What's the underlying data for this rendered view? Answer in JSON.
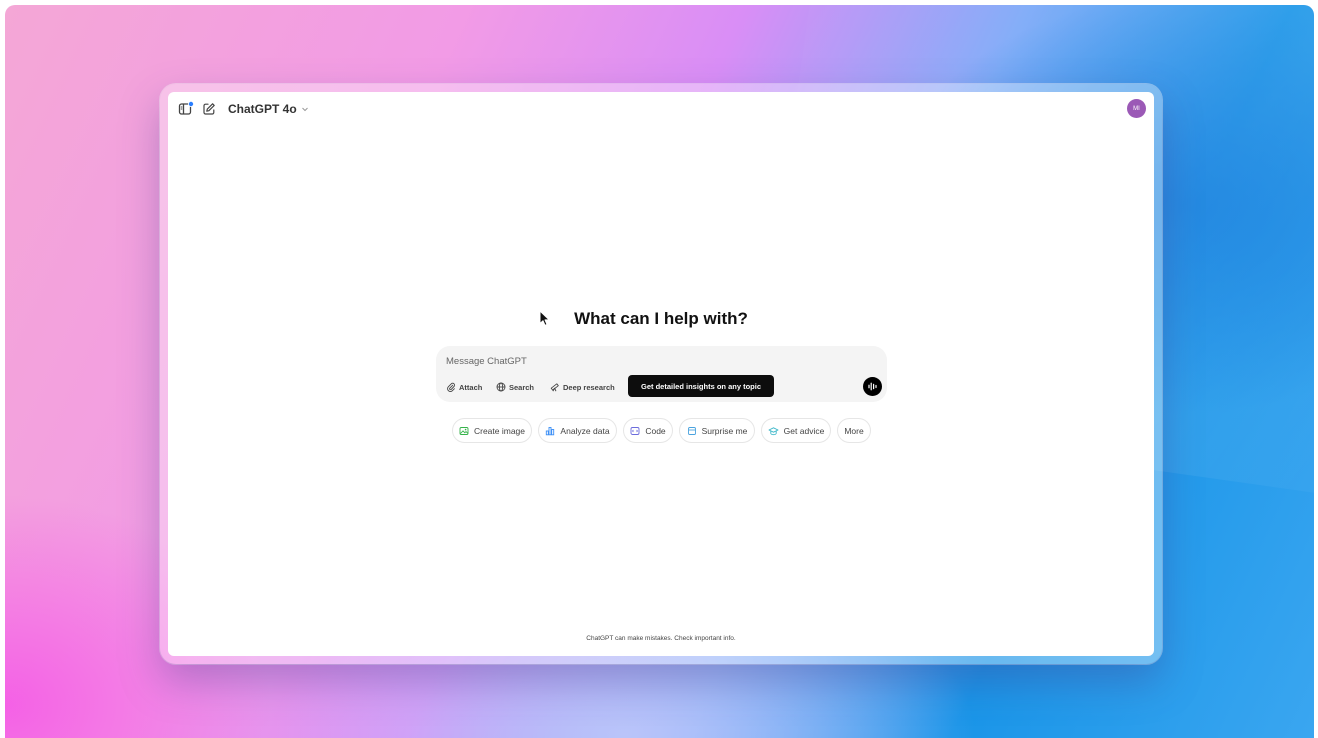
{
  "header": {
    "model_name": "ChatGPT 4o",
    "avatar_initials": "MI",
    "avatar_color": "#9b59b6"
  },
  "main": {
    "heading": "What can I help with?",
    "composer": {
      "placeholder": "Message ChatGPT",
      "tools": {
        "attach": "Attach",
        "search": "Search",
        "deep_research": "Deep research"
      },
      "tooltip": "Get detailed insights on any topic"
    },
    "suggestions": {
      "create_image": "Create image",
      "analyze_data": "Analyze data",
      "code": "Code",
      "surprise_me": "Surprise me",
      "get_advice": "Get advice",
      "more": "More"
    },
    "disclaimer": "ChatGPT can make mistakes. Check important info."
  },
  "icons": {
    "sidebar": "sidebar-toggle-icon",
    "new_chat": "new-chat-icon",
    "chevron": "chevron-down-icon",
    "attach": "paperclip-icon",
    "search": "globe-icon",
    "deep_research": "telescope-icon",
    "voice": "voice-waveform-icon",
    "create_image": "image-icon",
    "analyze_data": "bar-chart-icon",
    "code": "code-icon",
    "surprise_me": "gift-icon",
    "get_advice": "graduation-cap-icon"
  },
  "colors": {
    "accent_badge": "#2b7fff",
    "create_image": "#35b34a",
    "analyze_data": "#3a8ef6",
    "code": "#6b6bdc",
    "surprise_me": "#4aa3df",
    "get_advice": "#39b6c8"
  }
}
